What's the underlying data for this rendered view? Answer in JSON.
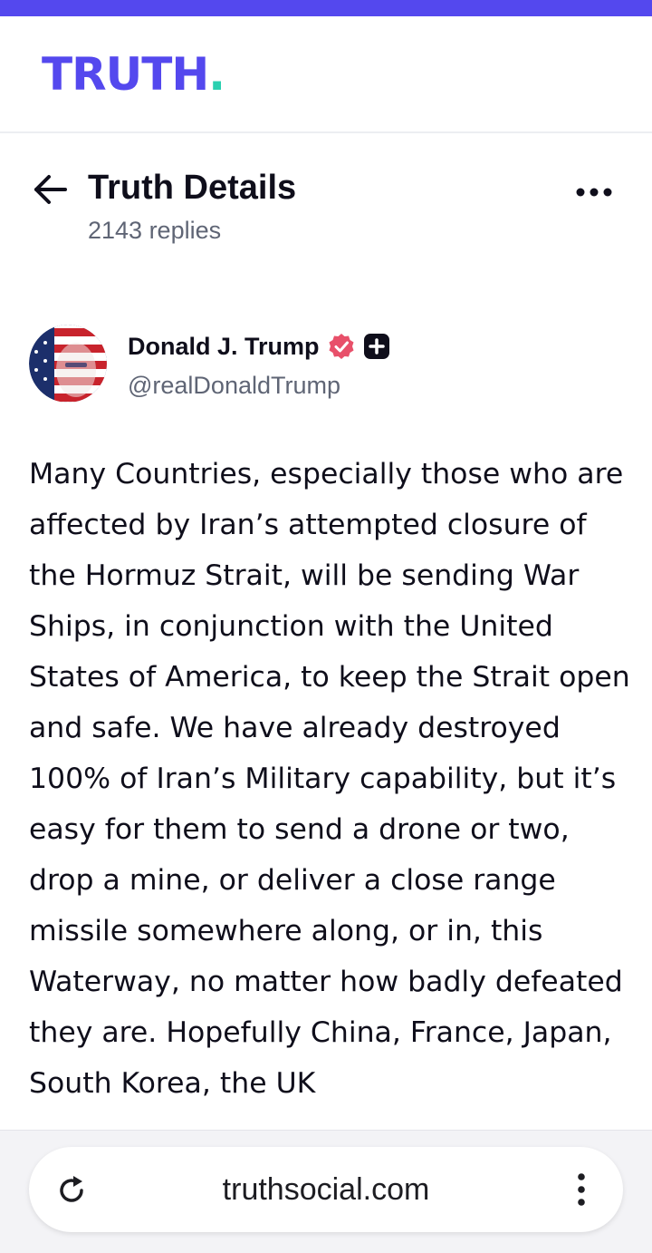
{
  "brand": {
    "logo_text": "TRUTH",
    "logo_dot": ".",
    "accent_color": "#5448ee",
    "dot_color": "#2ad0b0"
  },
  "header": {
    "title": "Truth Details",
    "replies": "2143 replies",
    "back_icon": "arrow-left-icon",
    "more_icon": "more-horizontal-icon"
  },
  "author": {
    "name": "Donald J. Trump",
    "handle": "@realDonaldTrump",
    "verified_icon": "verified-badge-icon",
    "verified_color": "#e8506a",
    "plus_icon": "plus-square-icon"
  },
  "post": {
    "text": "Many Countries, especially those who are affected by Iran’s attempted closure of the Hormuz Strait, will be sending War Ships, in conjunction with the United States of America, to keep the Strait open and safe. We have already destroyed 100% of Iran’s Military capability, but it’s easy for them to send a drone or two, drop a mine, or deliver a close range missile somewhere along, or in, this Waterway, no matter how badly defeated they are. Hopefully China, France, Japan, South Korea, the UK"
  },
  "browser": {
    "url": "truthsocial.com",
    "reload_icon": "reload-icon",
    "menu_icon": "more-vertical-icon"
  }
}
